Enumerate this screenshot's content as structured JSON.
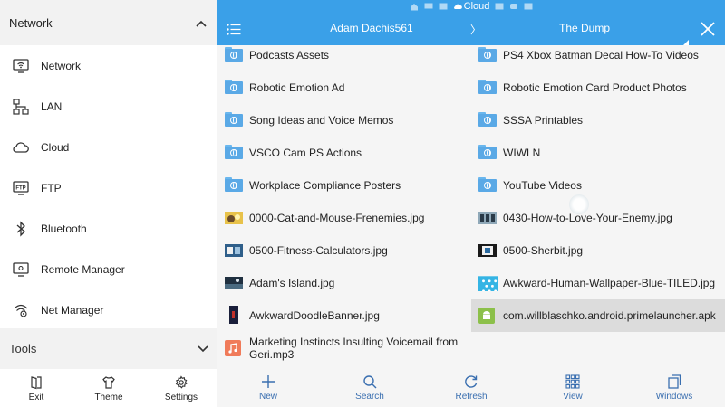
{
  "sidebar": {
    "network_header": "Network",
    "items": [
      {
        "label": "Network",
        "icon": "wifi-monitor-icon"
      },
      {
        "label": "LAN",
        "icon": "lan-icon"
      },
      {
        "label": "Cloud",
        "icon": "cloud-icon"
      },
      {
        "label": "FTP",
        "icon": "ftp-icon"
      },
      {
        "label": "Bluetooth",
        "icon": "bluetooth-icon"
      },
      {
        "label": "Remote Manager",
        "icon": "remote-manager-icon"
      },
      {
        "label": "Net Manager",
        "icon": "net-manager-icon"
      }
    ],
    "tools_header": "Tools",
    "bottom": {
      "exit": "Exit",
      "theme": "Theme",
      "settings": "Settings"
    }
  },
  "statusbar": {
    "label": "Cloud"
  },
  "titlebar": {
    "path_account": "Adam Dachis561",
    "separator": "〉",
    "path_folder": "The Dump"
  },
  "files": {
    "left": [
      {
        "name": "Podcasts Assets",
        "type": "folder"
      },
      {
        "name": "Robotic Emotion Ad",
        "type": "folder"
      },
      {
        "name": "Song Ideas and Voice Memos",
        "type": "folder"
      },
      {
        "name": "VSCO Cam PS Actions",
        "type": "folder"
      },
      {
        "name": "Workplace Compliance Posters",
        "type": "folder"
      },
      {
        "name": "0000-Cat-and-Mouse-Frenemies.jpg",
        "type": "image"
      },
      {
        "name": "0500-Fitness-Calculators.jpg",
        "type": "image"
      },
      {
        "name": "Adam's Island.jpg",
        "type": "image"
      },
      {
        "name": "AwkwardDoodleBanner.jpg",
        "type": "image"
      },
      {
        "name": "Marketing Instincts Insulting Voicemail from Geri.mp3",
        "type": "audio"
      }
    ],
    "right": [
      {
        "name": "PS4 Xbox Batman Decal How-To Videos",
        "type": "folder"
      },
      {
        "name": "Robotic Emotion Card Product Photos",
        "type": "folder"
      },
      {
        "name": "SSSA Printables",
        "type": "folder"
      },
      {
        "name": "WIWLN",
        "type": "folder"
      },
      {
        "name": "YouTube Videos",
        "type": "folder"
      },
      {
        "name": "0430-How-to-Love-Your-Enemy.jpg",
        "type": "image"
      },
      {
        "name": "0500-Sherbit.jpg",
        "type": "image"
      },
      {
        "name": "Awkward-Human-Wallpaper-Blue-TILED.jpg",
        "type": "image"
      },
      {
        "name": "com.willblaschko.android.primelauncher.apk",
        "type": "apk",
        "selected": true
      }
    ]
  },
  "toolbar": {
    "new": "New",
    "search": "Search",
    "refresh": "Refresh",
    "view": "View",
    "windows": "Windows"
  },
  "colors": {
    "accent": "#3aa0e8",
    "folder": "#5aa9e6",
    "toolbar_icon": "#3a6fb0"
  }
}
